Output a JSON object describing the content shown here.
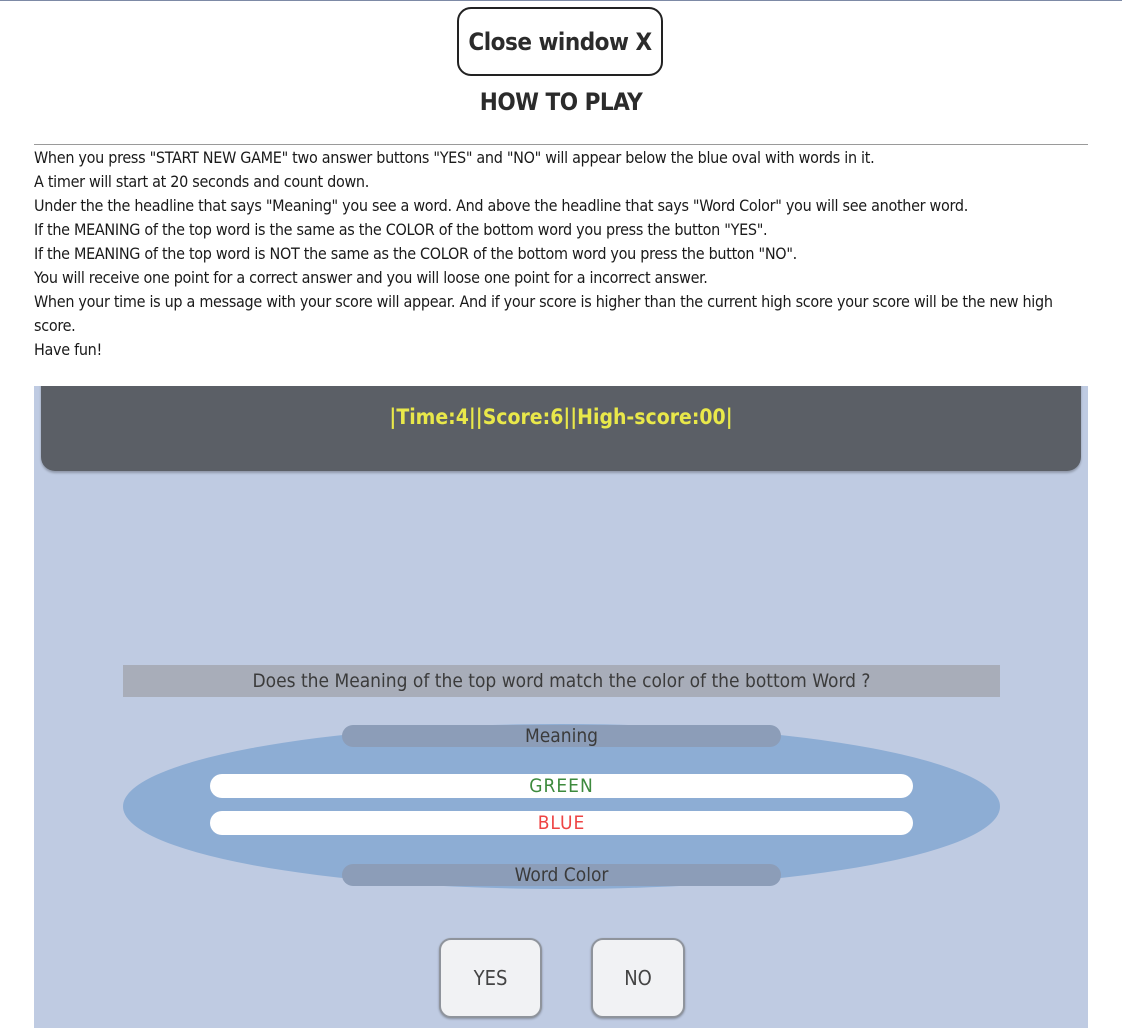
{
  "modal": {
    "close_label": "Close window X",
    "heading": "HOW TO PLAY",
    "instructions": [
      "When you press \"START NEW GAME\" two answer buttons \"YES\" and \"NO\" will appear below the blue oval with words in it.",
      "A timer will start at 20 seconds and count down.",
      "Under the the headline that says \"Meaning\" you see a word. And above the headline that says \"Word Color\" you will see another word.",
      "If the MEANING of the top word is the same as the COLOR of the bottom word you press the button \"YES\".",
      "If the MEANING of the top word is NOT the same as the COLOR of the bottom word you press the button \"NO\".",
      "You will receive one point for a correct answer and you will loose one point for a incorrect answer.",
      "When your time is up a message with your score will appear. And if your score is higher than the current high score your score will be the new high score.",
      "Have fun!"
    ]
  },
  "game_screenshot": {
    "scorebar": {
      "separator": "|",
      "time_label": "Time:",
      "time_value": "4",
      "score_label": "Score:",
      "score_value": "6",
      "highscore_label": "High-score:",
      "highscore_value": "00"
    },
    "question": "Does the Meaning of the top word match the color of the bottom Word ?",
    "meaning_label": "Meaning",
    "top_word": "GREEN",
    "top_word_color": "#3d8a3d",
    "bottom_word": "BLUE",
    "bottom_word_color": "#ee4444",
    "word_color_label": "Word Color",
    "yes_label": "YES",
    "no_label": "NO"
  },
  "colors": {
    "game_background": "#bfcbe2",
    "scorebar_background": "#5b5f66",
    "scorebar_text": "#e9e84a",
    "oval": "#8dadd4"
  }
}
